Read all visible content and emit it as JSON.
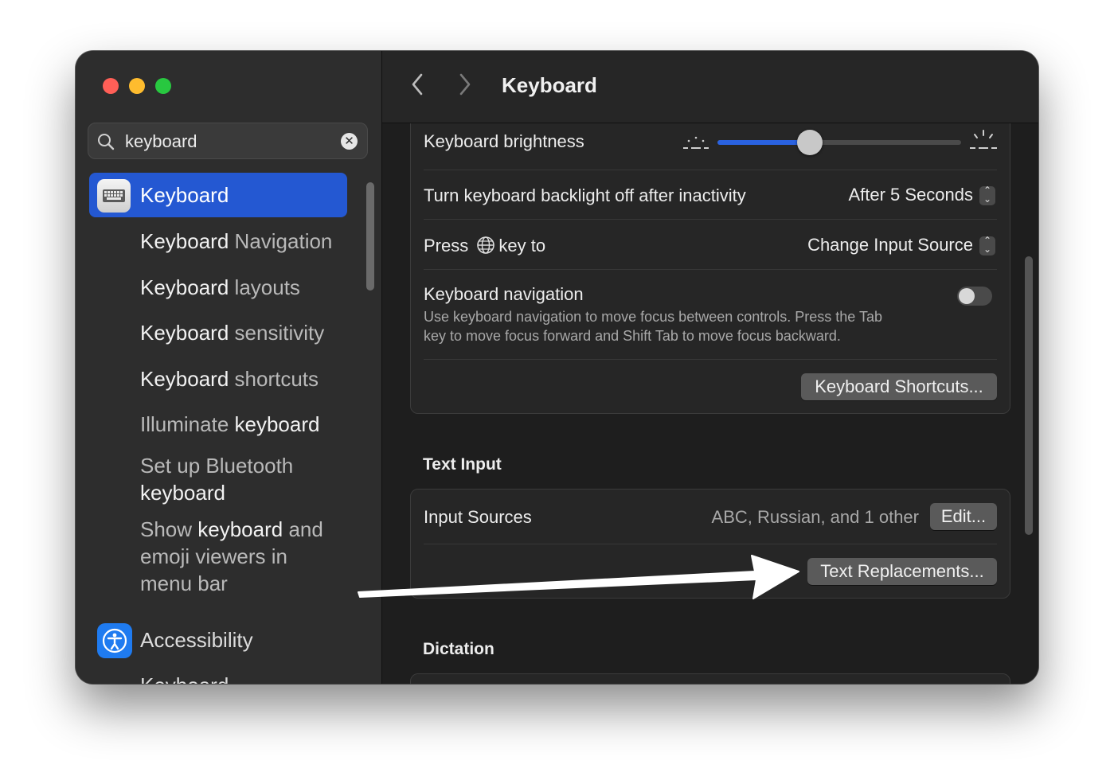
{
  "colors": {
    "accent": "#2458d2",
    "close": "#ff5f57",
    "minimize": "#febc2e",
    "zoom": "#28c840"
  },
  "search": {
    "value": "keyboard",
    "clear_icon": "clear-icon"
  },
  "sidebar": {
    "selected": {
      "label": "Keyboard",
      "icon": "keyboard-icon"
    },
    "results": [
      {
        "bold": "Keyboard",
        "rest": " Navigation"
      },
      {
        "bold": "Keyboard",
        "rest": " layouts"
      },
      {
        "bold": "Keyboard",
        "rest": " sensitivity"
      },
      {
        "bold": "Keyboard",
        "rest": " shortcuts"
      },
      {
        "pre": "Illuminate ",
        "bold": "keyboard"
      },
      {
        "pre1": "Set up Bluetooth",
        "bold": "keyboard"
      },
      {
        "pre": "Show ",
        "bold": "keyboard",
        "rest": " and",
        "line2": "emoji viewers in",
        "line3": "menu bar"
      }
    ],
    "accessibility": {
      "label": "Accessibility",
      "icon": "accessibility-icon"
    },
    "cut_item": "Keyboard"
  },
  "header": {
    "title": "Keyboard",
    "back_icon": "chevron-left-icon",
    "forward_icon": "chevron-right-icon"
  },
  "keyboard_settings": {
    "brightness": {
      "label": "Keyboard brightness",
      "value": 0.38
    },
    "backlight": {
      "label": "Turn keyboard backlight off after inactivity",
      "value": "After 5 Seconds"
    },
    "globe_key": {
      "label_pre": "Press",
      "label_post": "key to",
      "value": "Change Input Source",
      "icon": "globe-icon"
    },
    "navigation": {
      "label": "Keyboard navigation",
      "description_1": "Use keyboard navigation to move focus between controls. Press the Tab",
      "description_2": "key to move focus forward and Shift Tab to move focus backward.",
      "enabled": false
    },
    "shortcuts_button": "Keyboard Shortcuts..."
  },
  "text_input": {
    "section_title": "Text Input",
    "input_sources_label": "Input Sources",
    "input_sources_value": "ABC, Russian, and 1 other",
    "edit_button": "Edit...",
    "replacements_button": "Text Replacements..."
  },
  "dictation": {
    "section_title": "Dictation"
  }
}
